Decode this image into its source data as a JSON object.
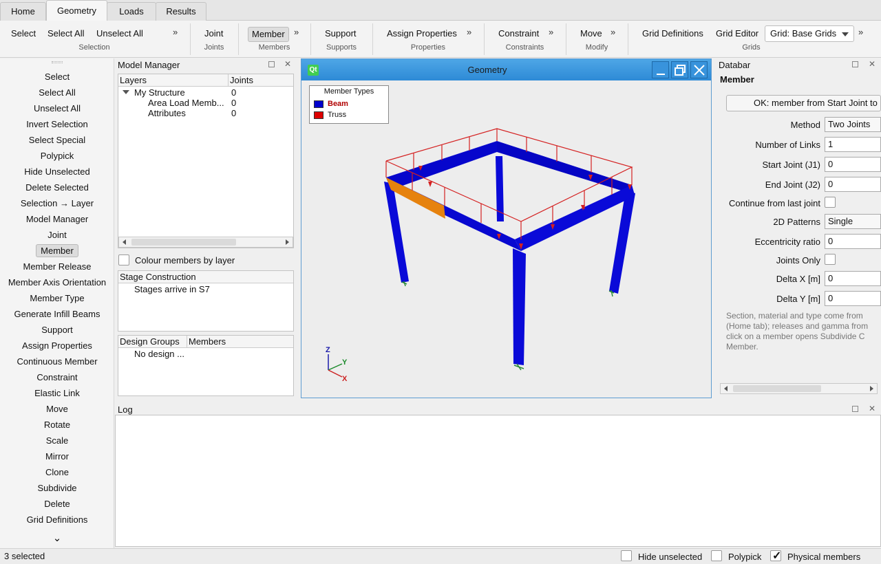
{
  "tabs": [
    "Home",
    "Geometry",
    "Loads",
    "Results"
  ],
  "active_tab": "Geometry",
  "ribbon": {
    "selection": {
      "buttons": [
        "Select",
        "Select All",
        "Unselect All"
      ],
      "group": "Selection"
    },
    "joints": {
      "button": "Joint",
      "group": "Joints"
    },
    "members": {
      "button": "Member",
      "group": "Members"
    },
    "supports": {
      "button": "Support",
      "group": "Supports"
    },
    "properties": {
      "button": "Assign Properties",
      "group": "Properties"
    },
    "constraints": {
      "button": "Constraint",
      "group": "Constraints"
    },
    "modify": {
      "button": "Move",
      "group": "Modify"
    },
    "grids": {
      "buttons": [
        "Grid Definitions",
        "Grid Editor"
      ],
      "combo": "Grid: Base Grids",
      "group": "Grids"
    },
    "more": "»"
  },
  "left_toolbar": {
    "items": [
      "Select",
      "Select All",
      "Unselect All",
      "Invert Selection",
      "Select Special",
      "Polypick",
      "Hide Unselected",
      "Delete Selected",
      "Selection → Layer",
      "Model Manager",
      "Joint",
      "Member",
      "Member Release",
      "Member Axis Orientation",
      "Member Type",
      "Generate Infill Beams",
      "Support",
      "Assign Properties",
      "Continuous Member",
      "Constraint",
      "Elastic Link",
      "Move",
      "Rotate",
      "Scale",
      "Mirror",
      "Clone",
      "Subdivide",
      "Delete",
      "Grid Definitions"
    ],
    "active": "Member",
    "more": "⌄"
  },
  "model_manager": {
    "title": "Model Manager",
    "columns": [
      "Layers",
      "Joints"
    ],
    "rows": [
      {
        "name": "My Structure",
        "joints": "0"
      },
      {
        "name": "Area Load Memb...",
        "joints": "0"
      },
      {
        "name": "Attributes",
        "joints": "0"
      }
    ],
    "colour_by_layer": "Colour members by layer",
    "stage_header": "Stage Construction",
    "stage_text": "Stages arrive in S7",
    "design_columns": [
      "Design Groups",
      "Members"
    ],
    "design_text": "No design ..."
  },
  "geometry": {
    "title": "Geometry",
    "app_badge": "Qt",
    "legend_title": "Member Types",
    "legend": [
      {
        "name": "Beam",
        "color": "#0000cc"
      },
      {
        "name": "Truss",
        "color": "#dd0000"
      }
    ],
    "axes": {
      "z": "Z",
      "y": "Y",
      "x": "X"
    }
  },
  "databar": {
    "title": "Databar",
    "heading": "Member",
    "ok_button": "OK: member from Start Joint to",
    "fields": [
      {
        "label": "Method",
        "value": "Two Joints",
        "kind": "select"
      },
      {
        "label": "Number of Links",
        "value": "1",
        "kind": "input"
      },
      {
        "label": "Start Joint (J1)",
        "value": "0",
        "kind": "input"
      },
      {
        "label": "End Joint (J2)",
        "value": "0",
        "kind": "input"
      },
      {
        "label": "Continue from last joint",
        "value": "",
        "kind": "check"
      },
      {
        "label": "2D Patterns",
        "value": "Single",
        "kind": "select"
      },
      {
        "label": "Eccentricity ratio",
        "value": "0",
        "kind": "input"
      },
      {
        "label": "Joints Only",
        "value": "",
        "kind": "check"
      },
      {
        "label": "Delta X [m]",
        "value": "0",
        "kind": "input"
      },
      {
        "label": "Delta Y [m]",
        "value": "0",
        "kind": "input"
      }
    ],
    "help": [
      "Section, material and type come from",
      "(Home tab); releases and gamma from",
      "click on a member opens Subdivide C",
      "Member."
    ]
  },
  "log": {
    "title": "Log"
  },
  "status": {
    "selected": "3 selected",
    "hide_unselected": "Hide unselected",
    "polypick": "Polypick",
    "physical_members": "Physical members",
    "physical_checked": true
  }
}
